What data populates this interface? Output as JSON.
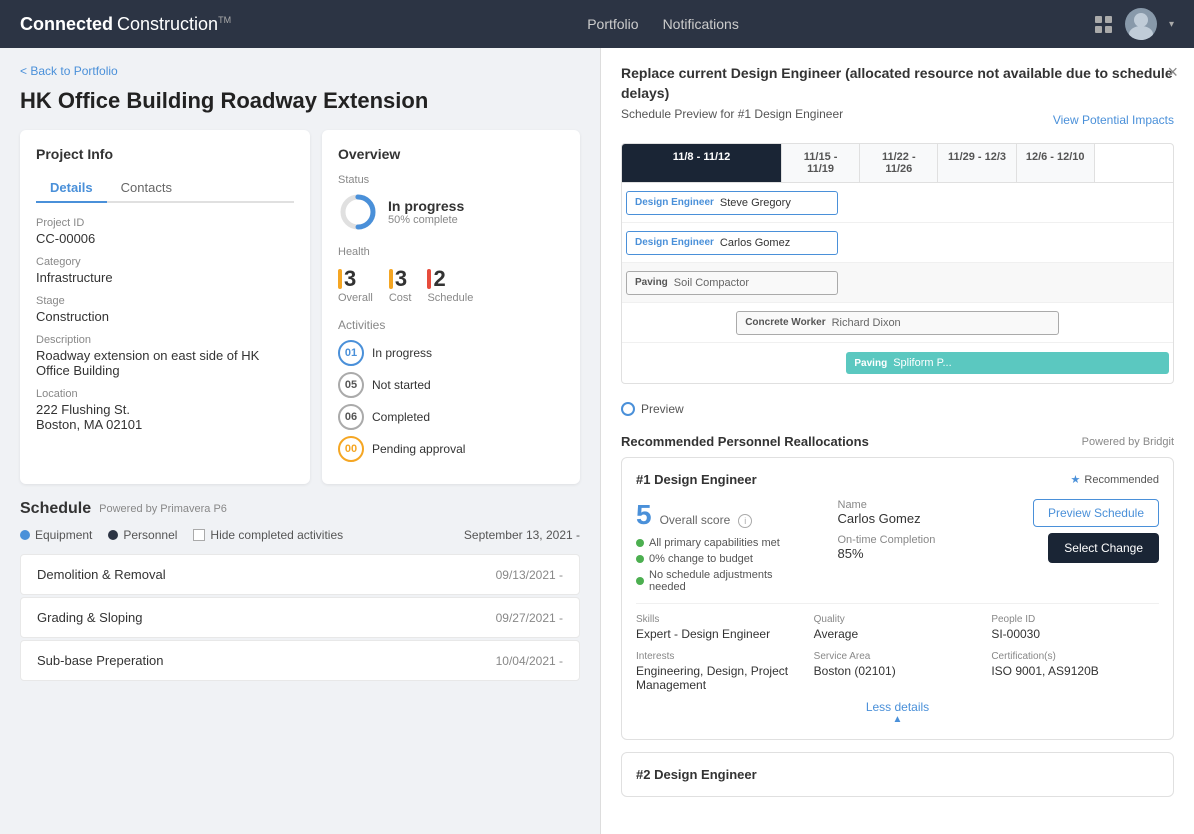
{
  "app": {
    "brand_bold": "Connected",
    "brand_light": "Construction",
    "brand_tm": "TM",
    "nav_portfolio": "Portfolio",
    "nav_notifications": "Notifications"
  },
  "left": {
    "back_link": "< Back to Portfolio",
    "page_title": "HK Office Building Roadway Extension",
    "project_info": {
      "card_title": "Project Info",
      "tab_details": "Details",
      "tab_contacts": "Contacts",
      "fields": [
        {
          "label": "Project ID",
          "value": "CC-00006"
        },
        {
          "label": "Category",
          "value": "Infrastructure"
        },
        {
          "label": "Stage",
          "value": "Construction"
        },
        {
          "label": "Description",
          "value": "Roadway extension on east side of HK Office Building"
        },
        {
          "label": "Location",
          "value": "222 Flushing St.\nBoston, MA 02101"
        }
      ]
    },
    "overview": {
      "card_title": "Overview",
      "status_label": "Status",
      "status_title": "In progress",
      "status_sub": "50% complete",
      "health_label": "Health",
      "health_items": [
        {
          "label": "Overall",
          "score": "3",
          "color": "#f5a623"
        },
        {
          "label": "Cost",
          "score": "3",
          "color": "#f5a623"
        },
        {
          "label": "Schedule",
          "score": "2",
          "color": "#e74c3c"
        }
      ],
      "activities_label": "Activities",
      "activities": [
        {
          "num": "01",
          "label": "In progress",
          "style": "blue"
        },
        {
          "num": "05",
          "label": "Not started",
          "style": "normal"
        },
        {
          "num": "06",
          "label": "Completed",
          "style": "normal"
        },
        {
          "num": "00",
          "label": "Pending approval",
          "style": "orange"
        }
      ]
    },
    "schedule": {
      "title": "Schedule",
      "powered_by": "Powered by Primavera P6",
      "legend": [
        {
          "type": "dot",
          "color": "#4a90d9",
          "label": "Equipment"
        },
        {
          "type": "dot",
          "color": "#2c3444",
          "label": "Personnel"
        },
        {
          "type": "checkbox",
          "label": "Hide completed activities"
        }
      ],
      "date": "September 13, 2021 -",
      "rows": [
        {
          "title": "Demolition & Removal",
          "date": "09/13/2021 -"
        },
        {
          "title": "Grading & Sloping",
          "date": "09/27/2021 -"
        },
        {
          "title": "Sub-base Preperation",
          "date": "10/04/2021 -"
        }
      ]
    }
  },
  "modal": {
    "title": "Replace current Design Engineer (allocated resource not available due to schedule delays)",
    "subtitle": "Schedule Preview for #1 Design Engineer",
    "view_impacts": "View Potential Impacts",
    "close_label": "×",
    "schedule_cols": [
      "11/8 - 11/12",
      "11/15 - 11/19",
      "11/22 - 11/26",
      "11/29 - 12/3",
      "12/6 - 12/10"
    ],
    "schedule_rows": [
      {
        "role": "Design Engineer",
        "name": "Steve Gregory",
        "style": "blue-outline",
        "col_start": 0,
        "col_span": 2
      },
      {
        "role": "Design Engineer",
        "name": "Carlos Gomez",
        "style": "blue-outline",
        "col_start": 0,
        "col_span": 2
      },
      {
        "role": "Paving",
        "name": "Soil Compactor",
        "style": "gray-outline",
        "col_start": 0,
        "col_span": 2
      },
      {
        "role": "Concrete Worker",
        "name": "Richard Dixon",
        "style": "gray-outline",
        "col_start": 1,
        "col_span": 3
      },
      {
        "role": "Paving",
        "name": "Spliform P...",
        "style": "teal",
        "col_start": 2,
        "col_span": 3
      }
    ],
    "preview_label": "Preview",
    "recommendations_title": "Recommended Personnel Reallocations",
    "recommendations_powered": "Powered by Bridgit",
    "rec1": {
      "title": "#1 Design Engineer",
      "recommended_label": "Recommended",
      "overall_score": "5",
      "score_label": "Overall score",
      "bullets": [
        "All primary capabilities met",
        "0% change to budget",
        "No schedule adjustments needed"
      ],
      "name_label": "Name",
      "name_value": "Carlos Gomez",
      "completion_label": "On-time Completion",
      "completion_value": "85%",
      "btn_preview": "Preview Schedule",
      "btn_select": "Select Change",
      "details": [
        {
          "label": "Skills",
          "value": "Expert - Design Engineer"
        },
        {
          "label": "Quality",
          "value": "Average"
        },
        {
          "label": "People ID",
          "value": "SI-00030"
        },
        {
          "label": "Interests",
          "value": "Engineering, Design, Project Management"
        },
        {
          "label": "Service Area",
          "value": "Boston (02101)"
        },
        {
          "label": "Certification(s)",
          "value": "ISO 9001, AS9120B"
        }
      ],
      "less_details": "Less details"
    },
    "rec2": {
      "title": "#2 Design Engineer"
    }
  }
}
